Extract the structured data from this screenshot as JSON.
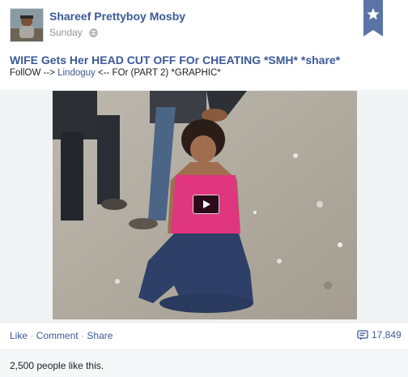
{
  "post": {
    "author": "Shareef Prettyboy Mosby",
    "time": "Sunday",
    "privacy_icon": "globe-icon",
    "title": "WIFE Gets Her HEAD CUT OFF FOr CHEATING *SMH* *share*",
    "subtitle": {
      "prefix": "FollOW --> ",
      "link": "Lindoguy",
      "suffix": " <-- FOr (PART 2) *GRAPHIC*"
    }
  },
  "video": {
    "play_icon": "play-icon"
  },
  "actions": {
    "like": "Like",
    "separator": "·",
    "comment": "Comment",
    "share": "Share",
    "share_count": "17,849"
  },
  "likes": {
    "text": "2,500 people like this."
  },
  "colors": {
    "link_blue": "#3b5998",
    "ribbon": "#5b74a8",
    "gray_text": "#90949c"
  }
}
